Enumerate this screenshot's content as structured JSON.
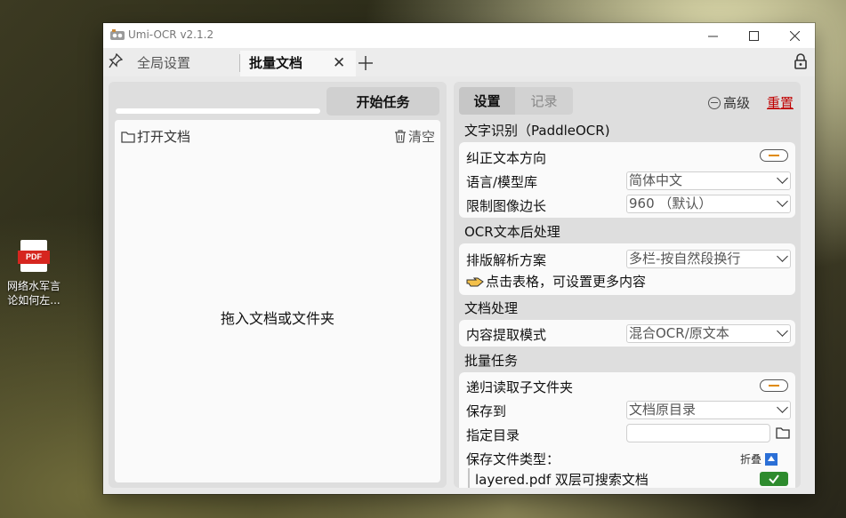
{
  "desktop": {
    "icon_badge": "PDF",
    "icon_label_line1": "网络水军言",
    "icon_label_line2": "论如何左..."
  },
  "window": {
    "title": "Umi-OCR v2.1.2",
    "minimize": "—",
    "maximize": "☐",
    "close": "✕"
  },
  "tabs": {
    "pin_icon": "pin-icon",
    "items": [
      {
        "label": "全局设置"
      },
      {
        "label": "批量文档",
        "active": true
      }
    ],
    "close_glyph": "✕",
    "add_glyph": "+"
  },
  "left": {
    "start_label": "开始任务",
    "open_label": "打开文档",
    "clear_label": "清空",
    "drop_text": "拖入文档或文件夹",
    "progress": 0
  },
  "right": {
    "tab_settings": "设置",
    "tab_log": "记录",
    "advanced_label": "高级",
    "reset_label": "重置",
    "accent_color": "#c00000",
    "sections": {
      "ocr": "文字识别（PaddleOCR)",
      "post": "OCR文本后处理",
      "doc": "文档处理",
      "batch": "批量任务"
    },
    "ocr": {
      "orientation_label": "纠正文本方向",
      "orientation_on": false,
      "language_label": "语言/模型库",
      "language_value": "简体中文",
      "limit_label": "限制图像边长",
      "limit_value": "960 （默认）"
    },
    "post": {
      "layout_label": "排版解析方案",
      "layout_value": "多栏-按自然段换行",
      "hint": "点击表格，可设置更多内容"
    },
    "doc": {
      "mode_label": "内容提取模式",
      "mode_value": "混合OCR/原文本"
    },
    "batch": {
      "recursive_label": "递归读取子文件夹",
      "recursive_on": false,
      "save_to_label": "保存到",
      "save_to_value": "文档原目录",
      "dir_label": "指定目录",
      "dir_value": "",
      "types_label": "保存文件类型：",
      "fold_label": "折叠",
      "type_item": "layered.pdf 双层可搜索文档",
      "type_item_checked": true
    }
  }
}
